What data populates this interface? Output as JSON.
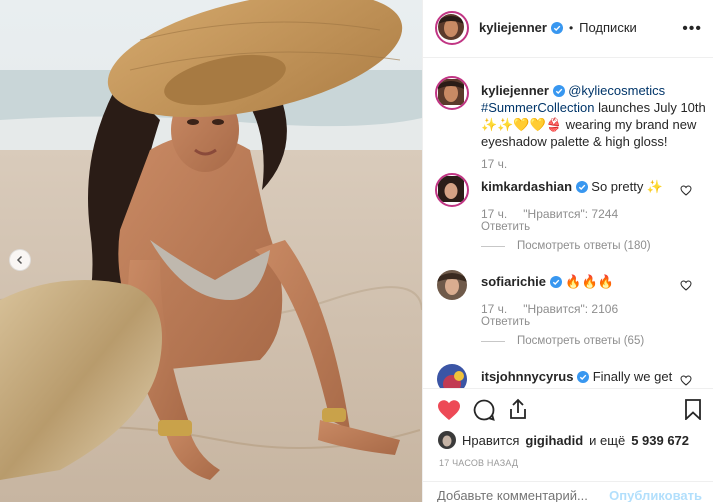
{
  "post": {
    "author": "kyliejenner",
    "follow_label": "Подписки",
    "more_label": "•••",
    "caption": {
      "author": "kyliejenner",
      "mention": "@kyliecosmetics",
      "hashtag": "#SummerCollection",
      "text_after_hashtag": "launches July 10th",
      "emoji_line": "✨✨💛💛👙",
      "text_rest": "wearing my brand new eyeshadow palette & high gloss!",
      "time": "17 ч."
    }
  },
  "comments": [
    {
      "user": "kimkardashian",
      "verified": true,
      "text": "So pretty ✨",
      "time": "17 ч.",
      "likes_label": "\"Нравится\": 7244",
      "reply_label": "Ответить",
      "view_replies_label": "Посмотреть ответы (180)"
    },
    {
      "user": "sofiarichie",
      "verified": true,
      "text": "🔥🔥🔥",
      "time": "17 ч.",
      "likes_label": "\"Нравится\": 2106",
      "reply_label": "Ответить",
      "view_replies_label": "Посмотреть ответы (65)"
    },
    {
      "user": "itsjohnnycyrus",
      "verified": true,
      "text": "Finally we get"
    }
  ],
  "actions": {
    "likes_prefix": "Нравится",
    "likes_user": "gigihadid",
    "likes_middle": "и ещё",
    "likes_count": "5 939 672",
    "time_ago": "17 ЧАСОВ НАЗАД",
    "comment_placeholder": "Добавьте комментарий...",
    "publish_label": "Опубликовать"
  },
  "colors": {
    "liked_heart": "#ed4956",
    "verified": "#3897f0",
    "link": "#003569",
    "muted": "#8e8e8e"
  },
  "icons": [
    "chevron-left-icon",
    "verified-icon",
    "more-icon",
    "heart-icon",
    "comment-icon",
    "share-icon",
    "bookmark-icon"
  ]
}
